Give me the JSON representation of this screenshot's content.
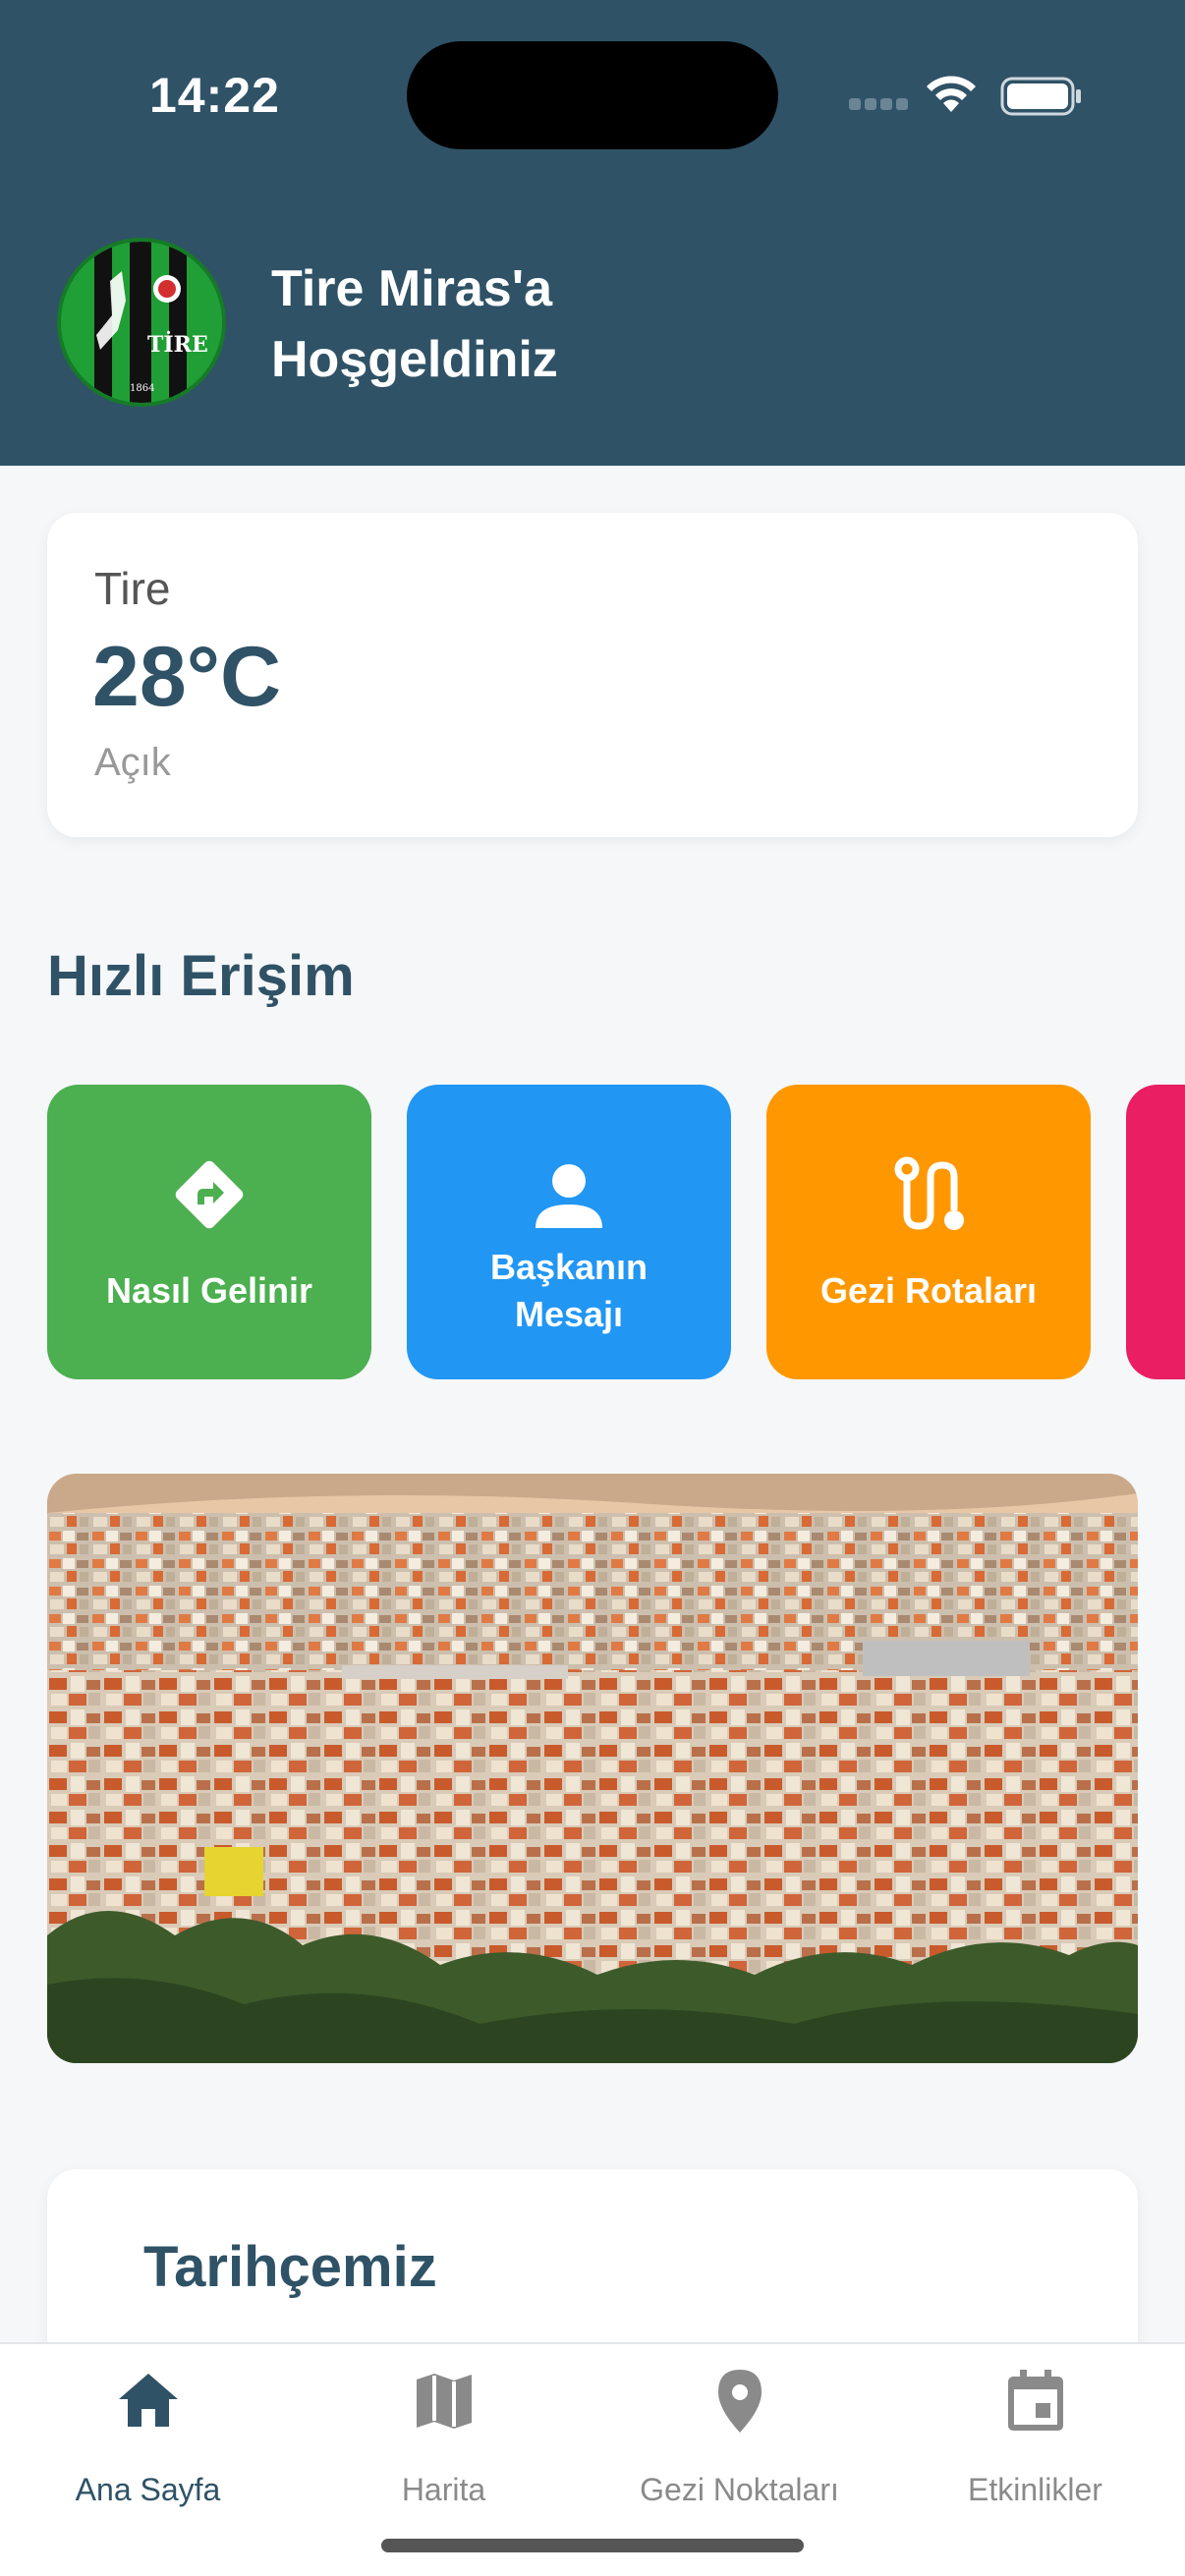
{
  "status_bar": {
    "time": "14:22"
  },
  "header": {
    "logo_text": "TİRE",
    "logo_year": "1864",
    "welcome_line1": "Tire Miras'a",
    "welcome_line2": "Hoşgeldiniz",
    "background_color": "#2f5266"
  },
  "weather": {
    "city": "Tire",
    "temperature": "28°C",
    "condition": "Açık"
  },
  "quick_access": {
    "title": "Hızlı Erişim",
    "tiles": [
      {
        "label": "Nasıl Gelinir",
        "icon": "directions-icon",
        "color": "#4caf50"
      },
      {
        "label_line1": "Başkanın",
        "label_line2": "Mesajı",
        "icon": "person-icon",
        "color": "#2196f3"
      },
      {
        "label": "Gezi Rotaları",
        "icon": "route-icon",
        "color": "#ff9800"
      },
      {
        "label": "",
        "icon": "",
        "color": "#e91e63"
      }
    ]
  },
  "history": {
    "title": "Tarihçemiz"
  },
  "bottom_nav": {
    "items": [
      {
        "label": "Ana Sayfa",
        "icon": "home-icon",
        "active": true
      },
      {
        "label": "Harita",
        "icon": "map-icon",
        "active": false
      },
      {
        "label": "Gezi Noktaları",
        "icon": "location-pin-icon",
        "active": false
      },
      {
        "label": "Etkinlikler",
        "icon": "calendar-icon",
        "active": false
      }
    ]
  }
}
